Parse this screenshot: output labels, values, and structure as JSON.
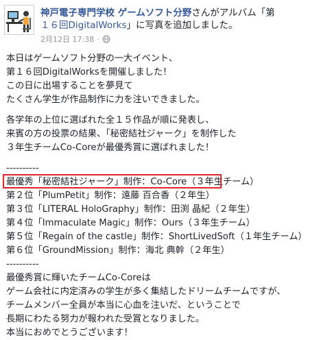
{
  "post": {
    "page_name": "神戸電子専門学校 ゲームソフト分野",
    "action_pre": "さんがアルバム「第",
    "album_title": "１６回DigitalWorks",
    "action_post": "」に写真を追加しました。",
    "date": "2月12日 17:38",
    "privacy_icon": "globe-icon"
  },
  "paragraphs": [
    [
      "本日はゲームソフト分野の一大イベント、",
      "第１６回DigitalWorksを開催しました！",
      "この日に出場することを夢見て",
      "たくさん学生が作品制作に力を注いできました。"
    ],
    [
      "各学年の上位に選ばれた全１５作品が順に発表し、",
      "来賓の方の投票の結果、「秘密結社ジャーク」を制作した",
      "３年生チームCo-Coreが最優秀賞に選ばれました！"
    ],
    [
      "----------",
      "最優秀「秘密結社ジャーク」制作：Co-Core（３年生チーム）",
      "第２位「PlumPetit」制作：遠藤 百合香（２年生）",
      "第３位「LITERAL HoloGraphy」制作：田渕 晶紀（２年生）",
      "第４位「Immaculate Magic」制作：Ours（３年生チーム）",
      "第５位「Regain of the castle」制作：ShortLivedSoft（１年生チーム）",
      "第６位「GroundMission」制作：海北 典幹（２年生）",
      "----------",
      "最優秀賞に輝いたチームCo-Coreは",
      "ゲーム会社に内定済みの学生が多く集結したドリームチームですが、",
      "チームメンバー全員が本当に心血を注いだ、ということで",
      "長期にわたる努力が報われた受賞となりました。",
      "本当におめでとうございます！"
    ]
  ],
  "colors": {
    "link": "#365899",
    "text": "#1d2129",
    "meta": "#90949c",
    "highlight_box": "#e2232a"
  }
}
